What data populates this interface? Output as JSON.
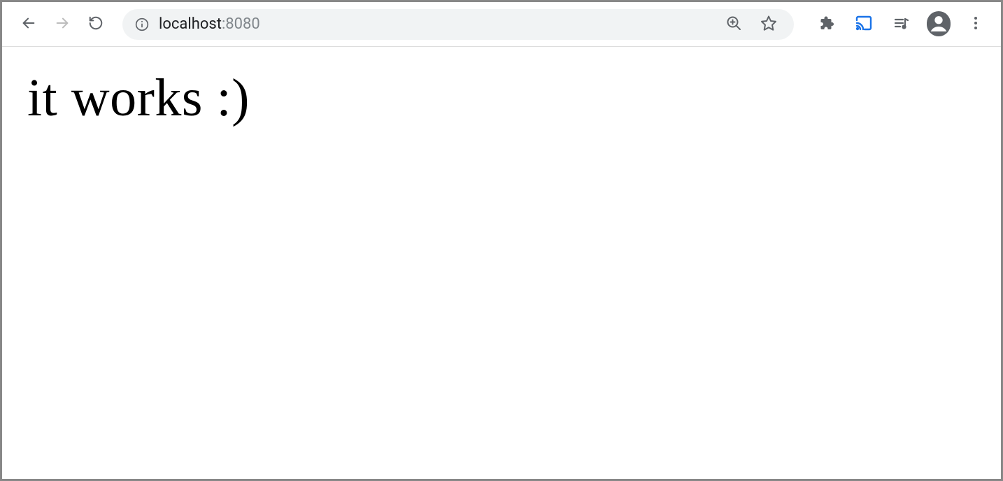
{
  "toolbar": {
    "url_host": "localhost",
    "url_port": ":8080"
  },
  "page": {
    "heading": "it works :)"
  }
}
